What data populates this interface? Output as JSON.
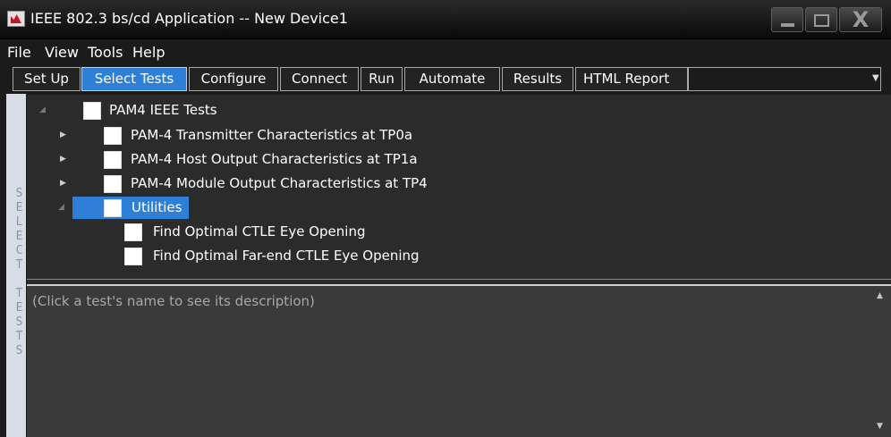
{
  "window": {
    "title": "IEEE 802.3 bs/cd Application -- New Device1",
    "minimize_glyph": "",
    "maximize_glyph": "",
    "close_glyph": "X"
  },
  "menu": [
    "File",
    "View",
    "Tools",
    "Help"
  ],
  "tabs": [
    {
      "label": "Set Up",
      "active": false
    },
    {
      "label": "Select Tests",
      "active": true
    },
    {
      "label": "Configure",
      "active": false
    },
    {
      "label": "Connect",
      "active": false
    },
    {
      "label": "Run",
      "active": false
    },
    {
      "label": "Automate",
      "active": false
    },
    {
      "label": "Results",
      "active": false
    },
    {
      "label": "HTML Report",
      "active": false
    }
  ],
  "side_label": "SELECT TESTS",
  "tree": {
    "root": {
      "label": "PAM4 IEEE Tests",
      "expanded": true,
      "checked": false
    },
    "groups": [
      {
        "label": "PAM-4 Transmitter Characteristics at TP0a",
        "expanded": false,
        "checked": false
      },
      {
        "label": "PAM-4 Host Output Characteristics at TP1a",
        "expanded": false,
        "checked": false
      },
      {
        "label": "PAM-4 Module Output Characteristics at TP4",
        "expanded": false,
        "checked": false
      },
      {
        "label": "Utilities",
        "expanded": true,
        "checked": false,
        "selected": true
      }
    ],
    "utilities_items": [
      {
        "label": "Find Optimal CTLE Eye Opening",
        "checked": false
      },
      {
        "label": "Find Optimal Far-end CTLE Eye Opening",
        "checked": false
      }
    ]
  },
  "description": {
    "placeholder": "(Click a test's name to see its description)"
  },
  "colors": {
    "accent": "#2e7fd6",
    "background": "#1b1b1b",
    "tree_panel": "#2b2b2b",
    "desc_panel": "#3a3a3a",
    "side_strip": "#d6dde6"
  }
}
